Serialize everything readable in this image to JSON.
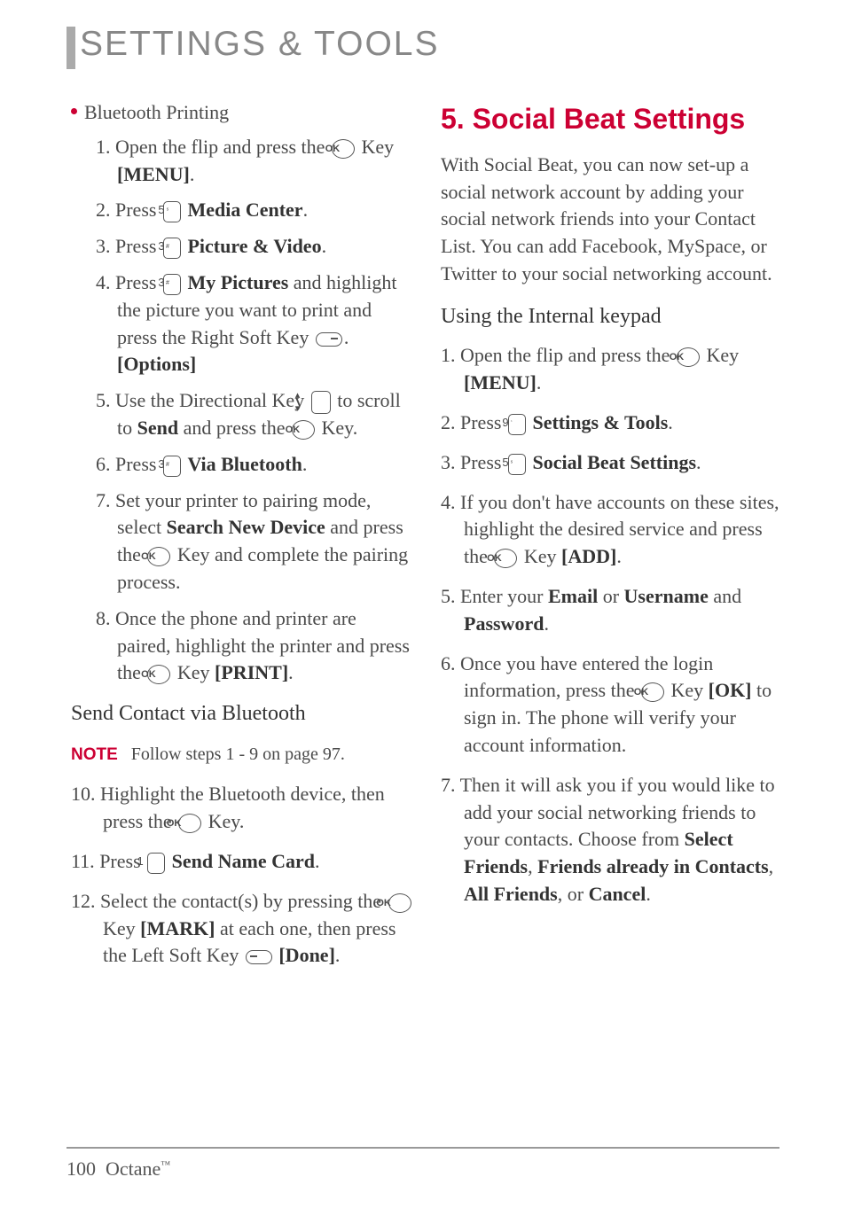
{
  "page_title": "SETTINGS & TOOLS",
  "left": {
    "bullet_title": "Bluetooth Printing",
    "steps": [
      {
        "n": "1.",
        "pre": "Open the flip and press the ",
        "icon": "ok",
        "post": " Key ",
        "bold2": "[MENU]",
        "post2": "."
      },
      {
        "n": "2.",
        "pre": "Press ",
        "key": "5",
        "sup": "ˢ",
        "post": " ",
        "bold": "Media Center",
        "post2": "."
      },
      {
        "n": "3.",
        "pre": "Press ",
        "key": "3",
        "sup": "#",
        "post": " ",
        "bold": "Picture & Video",
        "post2": "."
      },
      {
        "n": "4.",
        "pre": "Press ",
        "key": "3",
        "sup": "#",
        "post": " ",
        "bold": "My Pictures",
        "post2": " and highlight the picture you want to print and press the Right Soft Key ",
        "icon2": "soft",
        "bold3": " [Options]",
        "post3": "."
      },
      {
        "n": "5.",
        "pre": "Use the Directional Key ",
        "icon": "dir",
        "post": " to scroll to ",
        "bold": "Send",
        "post2": " and press the ",
        "icon2": "ok",
        "post3": " Key."
      },
      {
        "n": "6.",
        "pre": "Press ",
        "key": "3",
        "sup": "#",
        "post": " ",
        "bold": "Via Bluetooth",
        "post2": "."
      },
      {
        "n": "7.",
        "pre": "Set your printer to pairing mode, select ",
        "bold": "Search New Device",
        "post2": " and press the ",
        "icon2": "ok",
        "post3": " Key and complete the pairing process."
      },
      {
        "n": "8.",
        "pre": "Once the phone and printer are paired, highlight the printer and press the ",
        "icon": "ok",
        "post": " Key ",
        "bold2": "[PRINT]",
        "post2": "."
      }
    ],
    "subhead": "Send Contact via Bluetooth",
    "note_label": "NOTE",
    "note_text": "Follow steps 1 - 9 on page 97.",
    "steps2": [
      {
        "n": "10.",
        "pre": "Highlight the Bluetooth device, then press the ",
        "icon": "ok",
        "post": " Key."
      },
      {
        "n": "11.",
        "pre": "Press ",
        "key": "1",
        "sup": "",
        "post": " ",
        "bold": "Send Name Card",
        "post2": "."
      },
      {
        "n": "12.",
        "pre": "Select the contact(s) by pressing the ",
        "icon": "ok",
        "post": " Key ",
        "bold2": "[MARK]",
        "post2": " at each one, then press the Left Soft Key ",
        "icon2": "soft-left",
        "post3": " ",
        "bold3": "[Done]",
        "post4": "."
      }
    ]
  },
  "right": {
    "heading": "5. Social Beat Settings",
    "intro": "With Social Beat, you can now set-up a social network account by adding your social network friends into your Contact List. You can add Facebook, MySpace, or Twitter to your social networking account.",
    "subheading": "Using the Internal keypad",
    "steps": [
      {
        "n": "1.",
        "pre": "Open the flip and press the ",
        "icon": "ok",
        "post": " Key ",
        "bold2": "[MENU]",
        "post2": "."
      },
      {
        "n": "2.",
        "pre": "Press ",
        "key": "9",
        "sup": "‘",
        "post": " ",
        "bold": "Settings & Tools",
        "post2": "."
      },
      {
        "n": "3.",
        "pre": "Press ",
        "key": "5",
        "sup": "ˢ",
        "post": " ",
        "bold": "Social Beat Settings",
        "post2": "."
      },
      {
        "n": "4.",
        "pre": "If you don't have accounts on these sites, highlight the desired service and press the ",
        "icon": "ok",
        "post": " Key ",
        "bold2": "[ADD]",
        "post2": "."
      },
      {
        "n": "5.",
        "pre": "Enter your ",
        "bold": "Email",
        "mid": " or ",
        "bold_b": "Username",
        "mid2": " and ",
        "bold_c": "Password",
        "post2": "."
      },
      {
        "n": "6.",
        "pre": "Once you have entered the login information, press the ",
        "icon": "ok",
        "post": " Key ",
        "bold2": "[OK]",
        "post2": " to sign in. The phone will verify your account information."
      },
      {
        "n": "7.",
        "pre": "Then it will ask you if you would like to add your social networking friends to your contacts. Choose from ",
        "bold": "Select Friends",
        "mid": ", ",
        "bold_b": "Friends already in Contacts",
        "mid2": ", ",
        "bold_c": "All Friends",
        "mid3": ", or ",
        "bold_d": "Cancel",
        "post2": "."
      }
    ]
  },
  "footer": {
    "page": "100",
    "model": "Octane",
    "tm": "™"
  }
}
